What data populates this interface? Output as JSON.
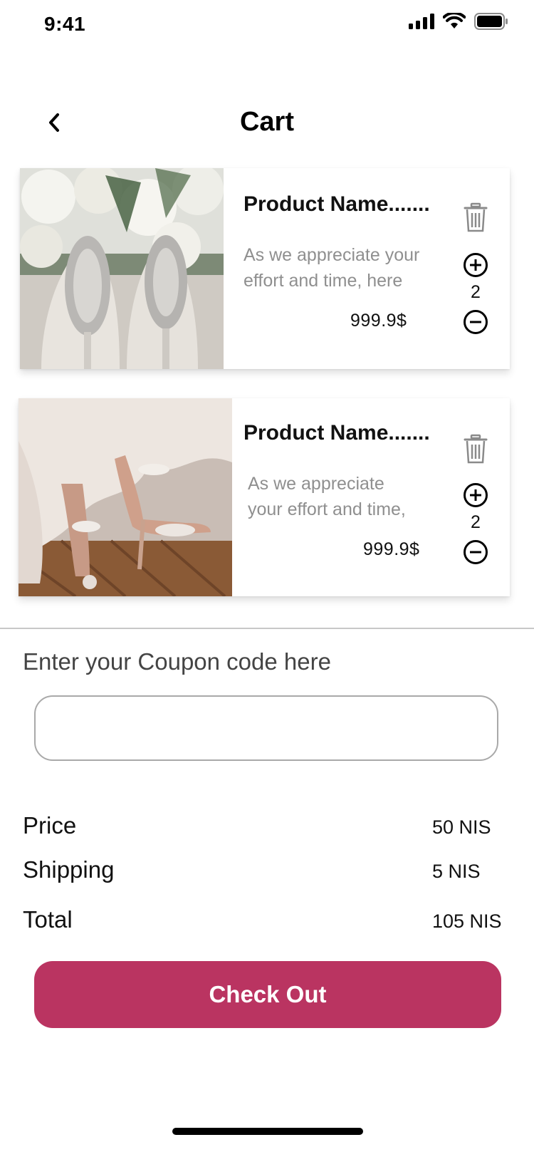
{
  "status_bar": {
    "time": "9:41"
  },
  "header": {
    "title": "Cart"
  },
  "cart": {
    "items": [
      {
        "name": "Product Name.......",
        "description": "As we appreciate your effort and time, here",
        "price": "999.9$",
        "quantity": "2"
      },
      {
        "name": "Product Name.......",
        "description": "As we appreciate your effort and time,",
        "price": "999.9$",
        "quantity": "2"
      }
    ]
  },
  "coupon": {
    "label": "Enter your Coupon code here",
    "value": "",
    "placeholder": ""
  },
  "summary": {
    "price_label": "Price",
    "price_value": "50 NIS",
    "shipping_label": "Shipping",
    "shipping_value": "5 NIS",
    "total_label": "Total",
    "total_value": "105 NIS"
  },
  "checkout": {
    "label": "Check Out"
  },
  "colors": {
    "accent": "#ba3461"
  },
  "icons": {
    "back": "chevron-left-icon",
    "delete": "trash-icon",
    "increase": "plus-circle-icon",
    "decrease": "minus-circle-icon"
  }
}
